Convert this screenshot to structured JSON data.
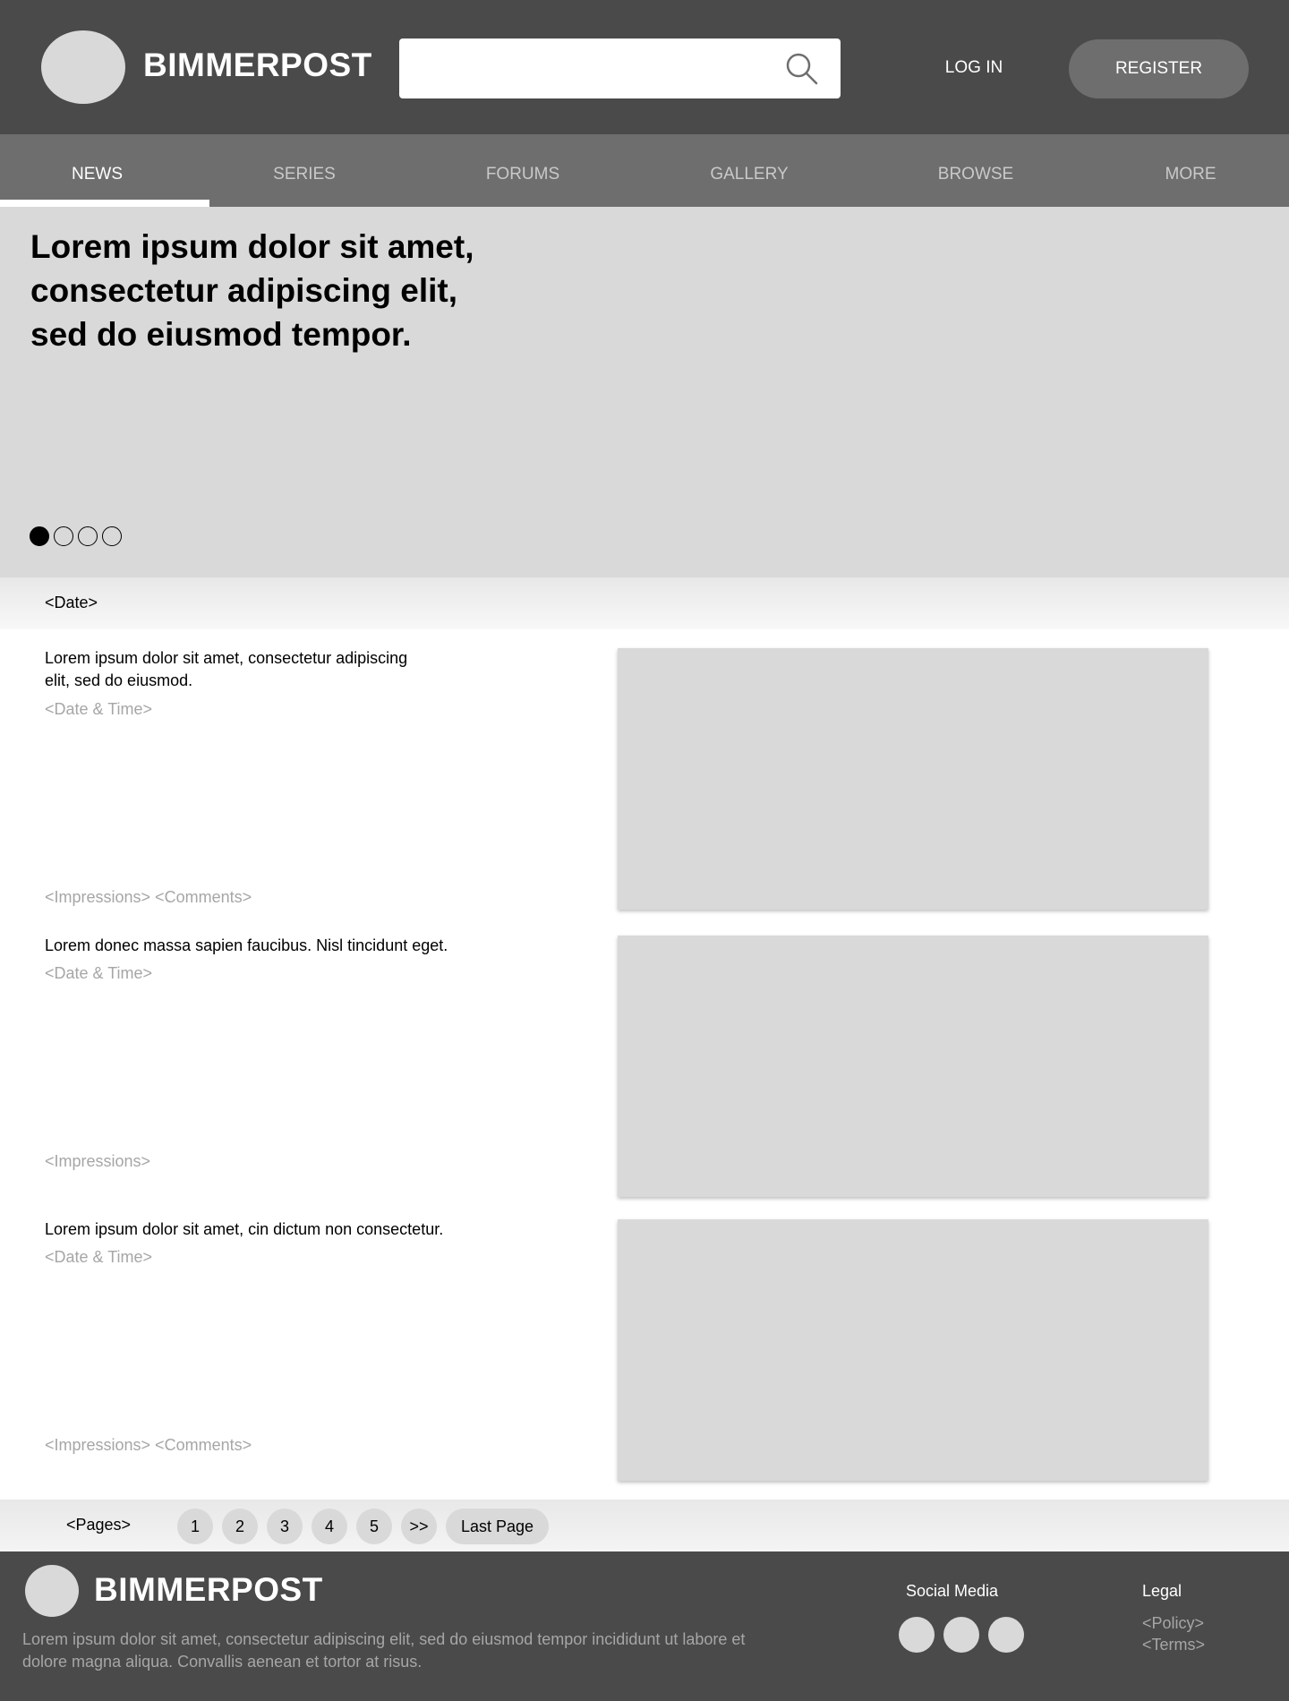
{
  "header": {
    "brand": "BIMMERPOST",
    "search": {
      "value": "",
      "placeholder": ""
    },
    "login_label": "LOG IN",
    "register_label": "REGISTER"
  },
  "nav": {
    "items": [
      {
        "label": "NEWS",
        "active": true
      },
      {
        "label": "SERIES",
        "active": false
      },
      {
        "label": "FORUMS",
        "active": false
      },
      {
        "label": "GALLERY",
        "active": false
      },
      {
        "label": "BROWSE",
        "active": false
      },
      {
        "label": "MORE",
        "active": false
      }
    ]
  },
  "hero": {
    "title_lines": [
      "Lorem ipsum dolor sit amet,",
      "consectetur adipiscing elit,",
      "sed do eiusmod tempor."
    ],
    "slides_total": 4,
    "active_slide": 1
  },
  "date_bar": {
    "label": "<Date>"
  },
  "articles": [
    {
      "title_lines": [
        "Lorem ipsum dolor sit amet, consectetur adipiscing",
        "elit, sed do eiusmod."
      ],
      "date": "<Date & Time>",
      "meta": "<Impressions> <Comments>"
    },
    {
      "title_lines": [
        "Lorem donec massa sapien faucibus. Nisl tincidunt eget."
      ],
      "date": "<Date & Time>",
      "meta": "<Impressions>"
    },
    {
      "title_lines": [
        "Lorem ipsum dolor sit amet, cin dictum non consectetur."
      ],
      "date": "<Date & Time>",
      "meta": "<Impressions> <Comments>"
    }
  ],
  "pagination": {
    "label": "<Pages>",
    "pages": [
      "1",
      "2",
      "3",
      "4",
      "5",
      ">>"
    ],
    "last_label": "Last Page"
  },
  "footer": {
    "brand": "BIMMERPOST",
    "text_lines": [
      "Lorem ipsum dolor sit amet, consectetur adipiscing elit, sed do eiusmod tempor incididunt ut labore et",
      "dolore magna aliqua. Convallis aenean et tortor at risus."
    ],
    "social_heading": "Social Media",
    "social_count": 3,
    "legal_heading": "Legal",
    "legal_links": [
      "<Policy>",
      "<Terms>"
    ]
  },
  "colors": {
    "header_bg": "#4a4a4a",
    "nav_bg": "#6e6e6e",
    "placeholder_gray": "#d9d9d9",
    "muted_text": "#a6a6a6"
  }
}
